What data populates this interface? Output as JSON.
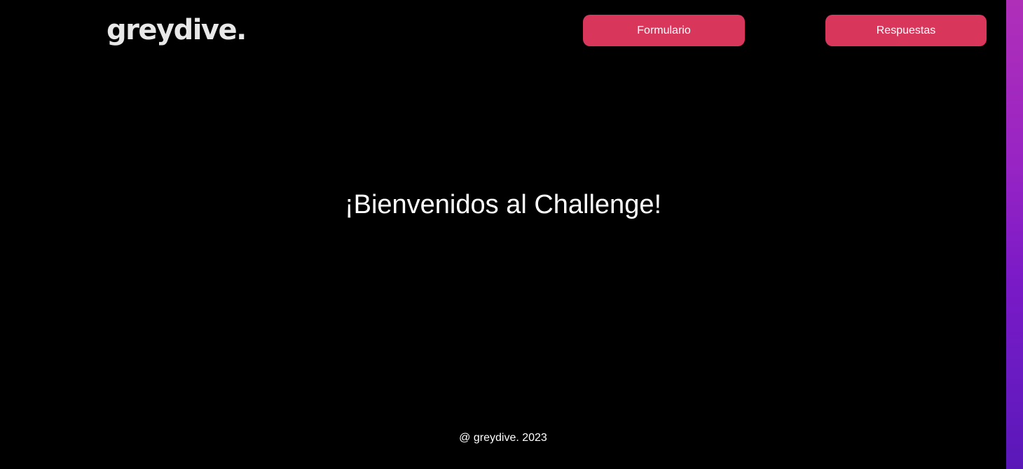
{
  "header": {
    "logo_text": "greydive.",
    "nav": {
      "form_label": "Formulario",
      "answers_label": "Respuestas"
    }
  },
  "main": {
    "headline": "¡Bienvenidos al Challenge!"
  },
  "footer": {
    "text": "@ greydive. 2023"
  },
  "colors": {
    "background": "#000000",
    "button": "#d9365b",
    "text": "#ffffff",
    "logo": "#e8e8e8",
    "desktop_strip": "#8a20c4"
  }
}
